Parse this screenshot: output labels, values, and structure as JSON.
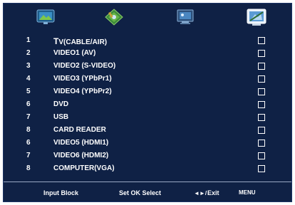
{
  "icons": [
    {
      "name": "tv-picture-icon"
    },
    {
      "name": "diamond-settings-icon"
    },
    {
      "name": "monitor-icon"
    },
    {
      "name": "input-lock-icon"
    }
  ],
  "inputs": [
    {
      "num": "1",
      "label_first": "T",
      "label_rest": "V(CABLE/AIR)"
    },
    {
      "num": "2",
      "label_first": "",
      "label_rest": "VIDEO1 (AV)"
    },
    {
      "num": "3",
      "label_first": "",
      "label_rest": "VIDEO2 (S-VIDEO)"
    },
    {
      "num": "4",
      "label_first": "",
      "label_rest": "VIDEO3 (YPbPr1)"
    },
    {
      "num": "5",
      "label_first": "",
      "label_rest": "VIDEO4 (YPbPr2)"
    },
    {
      "num": "6",
      "label_first": "",
      "label_rest": "DVD"
    },
    {
      "num": "7",
      "label_first": "",
      "label_rest": "USB"
    },
    {
      "num": "8",
      "label_first": "",
      "label_rest": "CARD READER"
    },
    {
      "num": "6",
      "label_first": "",
      "label_rest": "VIDEO5 (HDMI1)"
    },
    {
      "num": "7",
      "label_first": "",
      "label_rest": "VIDEO6 (HDMI2)"
    },
    {
      "num": "8",
      "label_first": "",
      "label_rest": "COMPUTER(VGA)"
    }
  ],
  "footer": {
    "title": "Input Block",
    "set": "Set OK Select",
    "arrows": "◄►/",
    "exit": "Exit",
    "menu": "MENU"
  },
  "colors": {
    "background": "#0f2145",
    "text": "#ffffff",
    "divider": "#9aa9c4"
  }
}
